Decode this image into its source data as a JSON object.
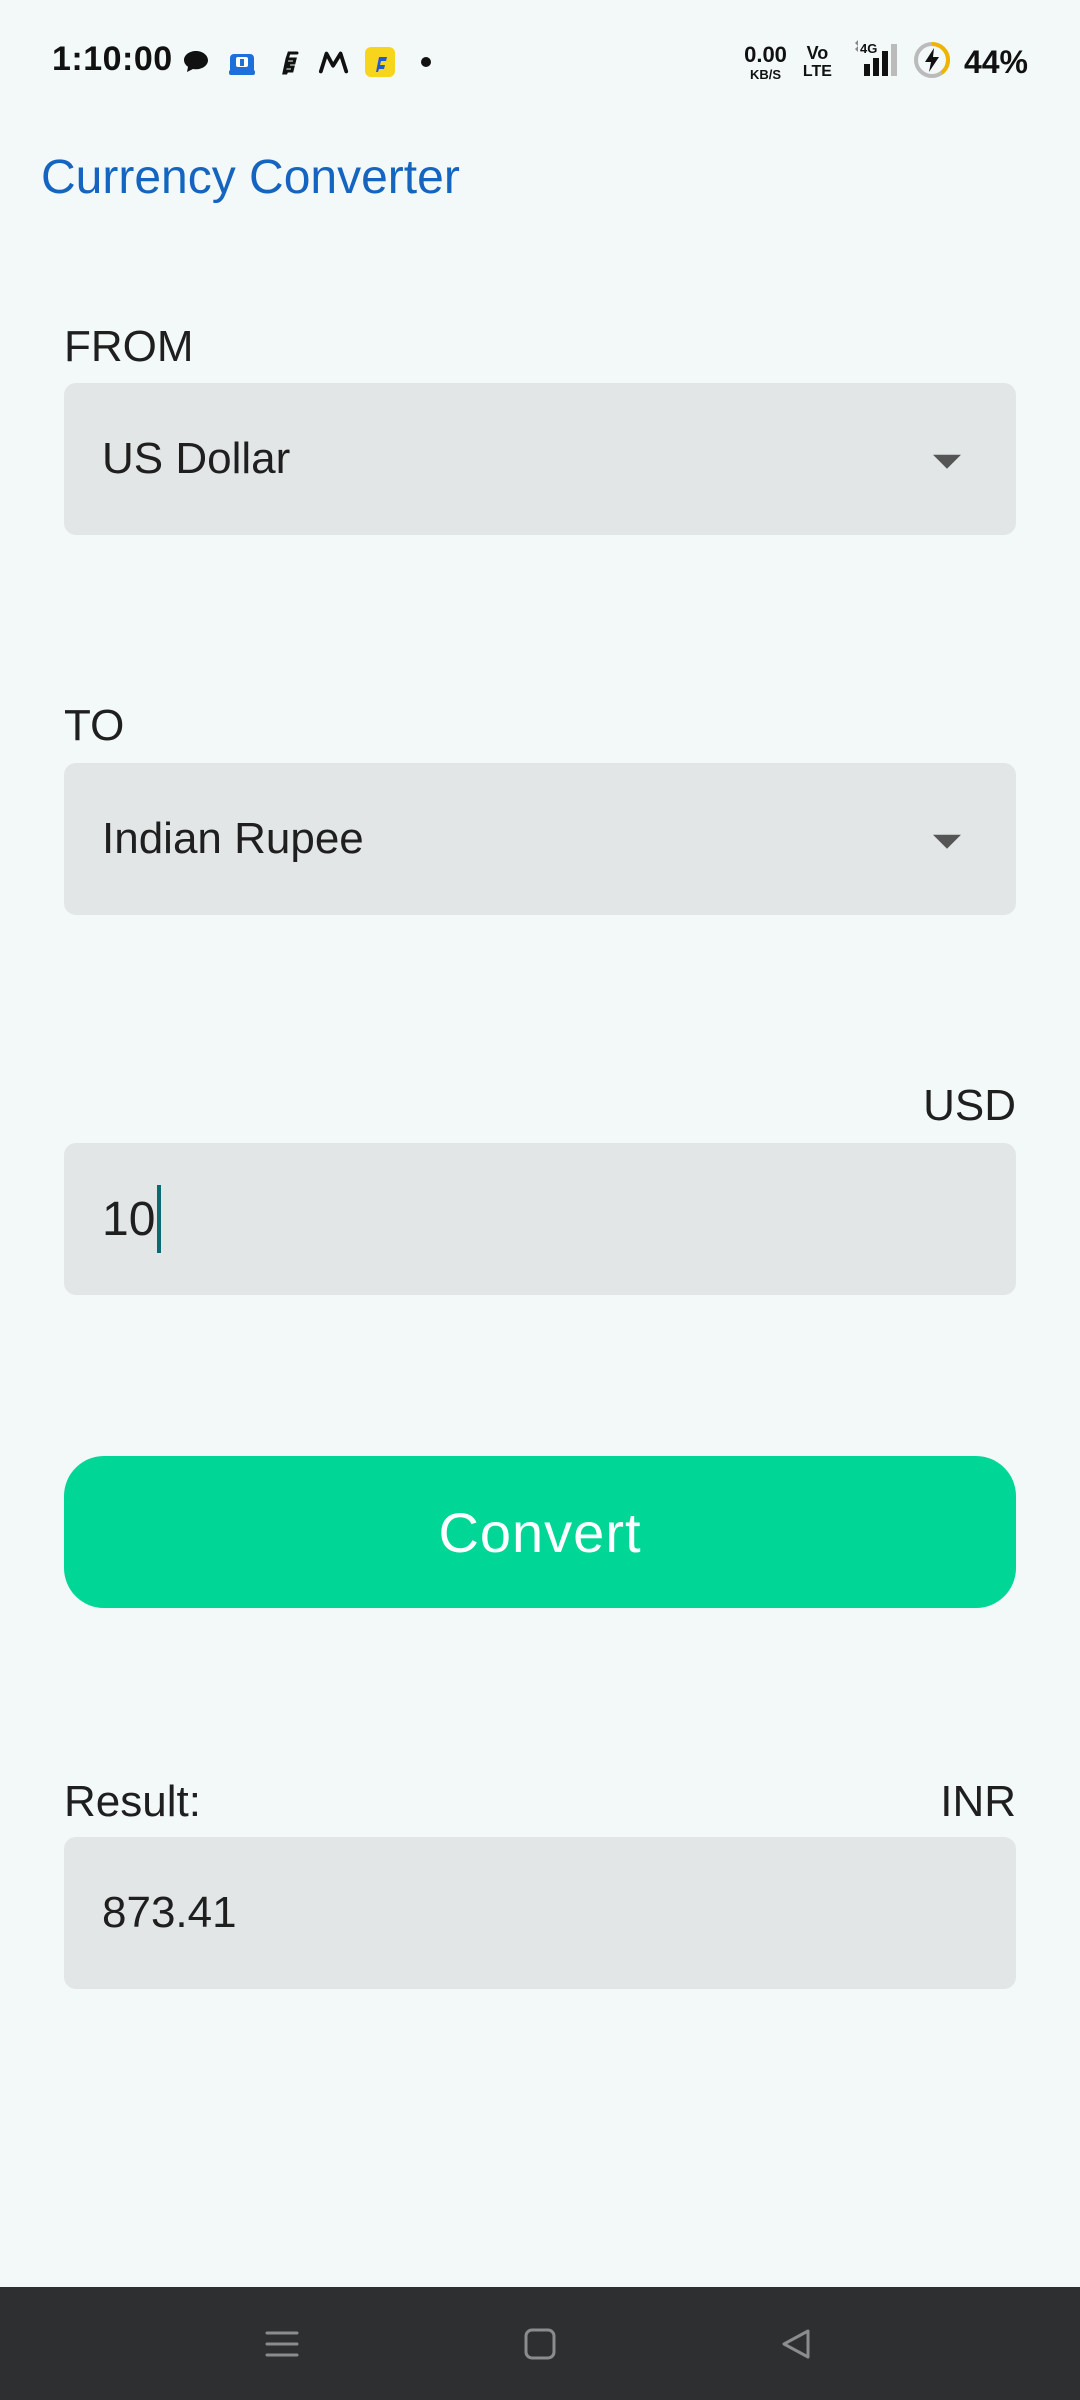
{
  "status_bar": {
    "time": "1:10:00",
    "notification_icons": [
      "chat-bubble-icon",
      "shopping-bag-icon",
      "flipkart-f-icon",
      "myntra-m-icon",
      "flipkart-app-icon",
      "dot-icon"
    ],
    "net_speed_value": "0.00",
    "net_speed_unit": "KB/S",
    "volte_top": "Vo",
    "volte_bottom": "LTE",
    "network_type": "4G",
    "battery_percent": "44%"
  },
  "app": {
    "title": "Currency Converter"
  },
  "from": {
    "label": "FROM",
    "selected": "US Dollar"
  },
  "to": {
    "label": "TO",
    "selected": "Indian Rupee"
  },
  "amount": {
    "currency_code": "USD",
    "value": "10"
  },
  "convert_button": {
    "label": "Convert"
  },
  "result": {
    "label": "Result:",
    "currency_code": "INR",
    "value": "873.41"
  },
  "nav_bar": {
    "buttons": [
      "menu-icon",
      "home-icon",
      "back-icon"
    ]
  },
  "colors": {
    "title": "#1565c0",
    "convert_button": "#00d696",
    "field_background": "#e3e6e7",
    "page_background": "#f3f9f9",
    "nav_bar": "#2d2f30"
  }
}
